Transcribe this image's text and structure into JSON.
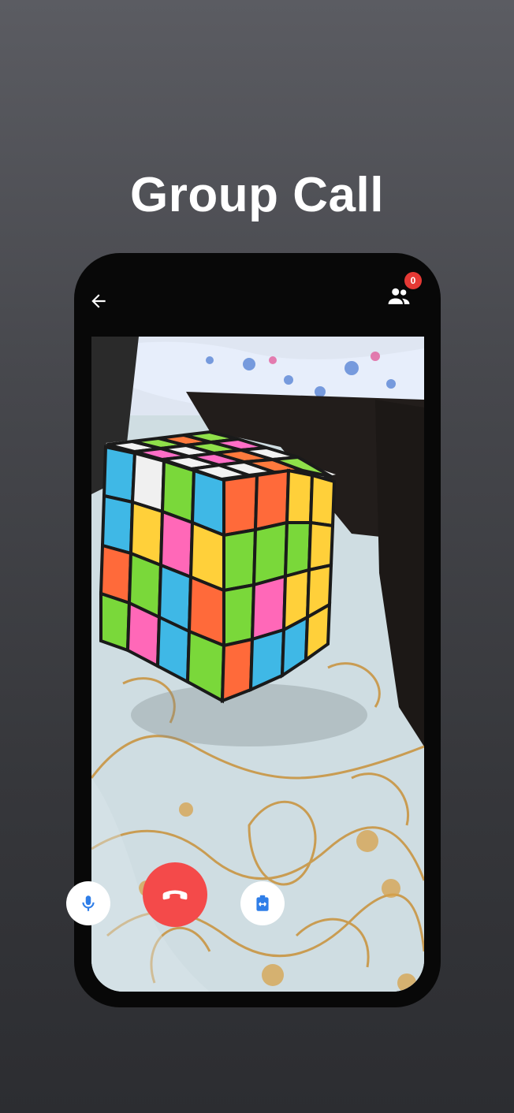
{
  "screen": {
    "title": "Group Call"
  },
  "top_bar": {
    "back_icon": "arrow-left-icon",
    "participants_icon": "people-icon",
    "participants_badge": "0"
  },
  "call_controls": {
    "mute_icon": "microphone-icon",
    "end_call_icon": "phone-hangup-icon",
    "switch_camera_icon": "camera-switch-icon"
  },
  "colors": {
    "end_call": "#f44a4a",
    "accent_blue": "#2f7ee8",
    "badge": "#e53935"
  }
}
